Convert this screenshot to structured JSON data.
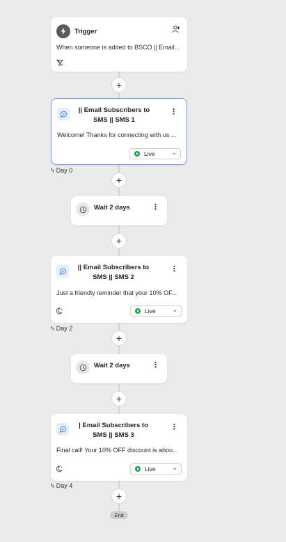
{
  "trigger": {
    "title": "Trigger",
    "description": "When someone is added to BSCO || Email..."
  },
  "steps": [
    {
      "title": "|| Email Subscribers to SMS || SMS 1",
      "message": "Welcome! Thanks for connecting with us ...",
      "status": "Live",
      "day": "Day 0"
    },
    {
      "wait": "Wait 2 days"
    },
    {
      "title": "|| Email Subscribers to SMS || SMS 2",
      "message": "Just a friendly reminder that your 10% OF...",
      "status": "Live",
      "day": "Day 2"
    },
    {
      "wait": "Wait 2 days"
    },
    {
      "title": "| Email Subscribers to SMS || SMS 3",
      "message": "Final call! Your 10% OFF discount is abou...",
      "status": "Live",
      "day": "Day 4"
    }
  ],
  "end_label": "End",
  "colors": {
    "background": "#ebebeb",
    "live_green": "#1e9e4a",
    "selected_border": "#7a9bd6"
  },
  "icons": {
    "trigger": "lightning-icon",
    "sms": "chat-bubble-icon",
    "wait": "clock-icon",
    "add_profile": "person-plus-icon",
    "no_filter": "filter-off-icon",
    "smart_send": "moon-icon"
  }
}
